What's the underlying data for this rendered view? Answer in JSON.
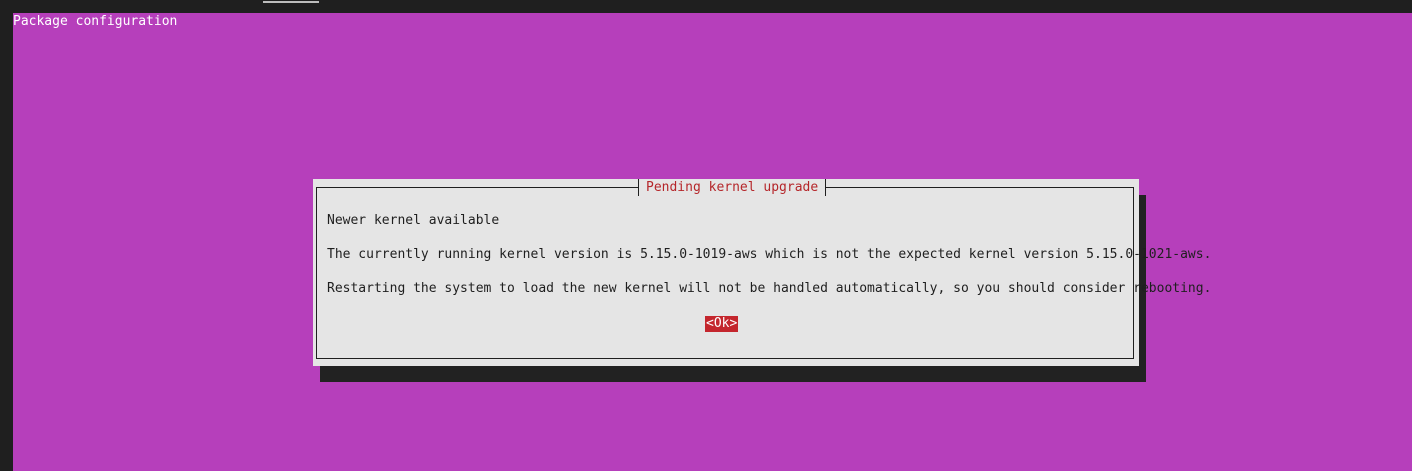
{
  "screen": {
    "backtitle": "Package configuration",
    "colors": {
      "background": "#b63fbb",
      "dialog": "#e5e5e5",
      "title_text": "#b5262a",
      "button_selected": "#c4262d"
    }
  },
  "dialog": {
    "title": "Pending kernel upgrade",
    "heading": "Newer kernel available",
    "message": "The currently running kernel version is 5.15.0-1019-aws which is not the expected kernel version 5.15.0-1021-aws.",
    "note": "Restarting the system to load the new kernel will not be handled automatically, so you should consider rebooting.",
    "ok_label": "<Ok>"
  }
}
